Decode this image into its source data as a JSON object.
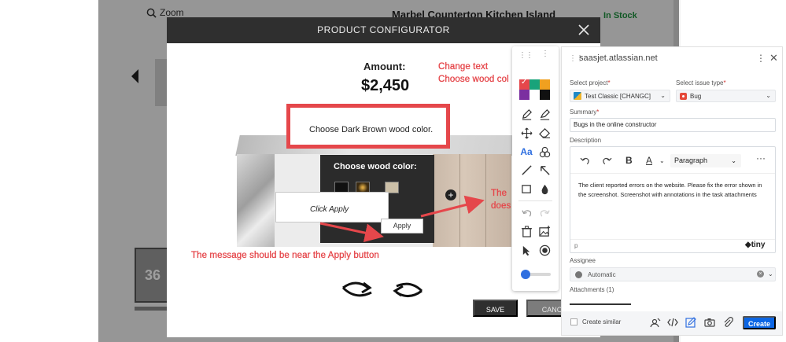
{
  "background_page": {
    "zoom_label": "Zoom",
    "product_title": "Marbel Counterton Kitchen Island",
    "stock_status": "In Stock",
    "thumb_360_label": "36"
  },
  "modal": {
    "title": "PRODUCT CONFIGURATOR",
    "amount_label": "Amount:",
    "amount_value": "$2,450",
    "wood_panel_title": "Choose wood color:",
    "apply_label": "Apply",
    "save_label": "SAVE",
    "cancel_label": "CANCEL"
  },
  "annotations": {
    "note_box_text": "Choose Dark Brown wood color.",
    "callout_text": "Click Apply",
    "red_line_1": "Change text",
    "red_line_2": "Choose wood color",
    "red_right_1": "The",
    "red_right_2": "does",
    "red_bottom": "The message should be near the Apply button"
  },
  "toolbar": {
    "palette_colors": [
      "#e5474b",
      "#19a37a",
      "#f0a020",
      "#7b2fa0",
      "#ffffff",
      "#111111"
    ],
    "tools": [
      "pencil-icon",
      "highlighter-icon",
      "move-icon",
      "eraser-icon",
      "text-icon",
      "blur-icon",
      "line-icon",
      "arrow-icon",
      "rectangle-icon",
      "fill-icon",
      "undo-icon",
      "redo-icon",
      "trash-icon",
      "add-image-icon",
      "pointer-icon",
      "record-icon"
    ],
    "accent_color": "#2f6fe0"
  },
  "jira_panel": {
    "host": "saasjet.atlassian.net",
    "project_label": "Select project",
    "project_value": "Test Classic [CHANGC]",
    "issue_type_label": "Select issue type",
    "issue_type_value": "Bug",
    "summary_label": "Summary",
    "summary_value": "Bugs in the online constructor",
    "description_label": "Description",
    "paragraph_style": "Paragraph",
    "description_text": "The client reported errors on the website. Please fix the error shown in the screenshot. Screenshot with annotations in the task attachments",
    "editor_path": "p",
    "editor_brand": "tiny",
    "assignee_label": "Assignee",
    "assignee_value": "Automatic",
    "attachments_label": "Attachments (1)",
    "create_similar_label": "Create similar",
    "create_label": "Create",
    "create_color": "#0c66e4"
  }
}
